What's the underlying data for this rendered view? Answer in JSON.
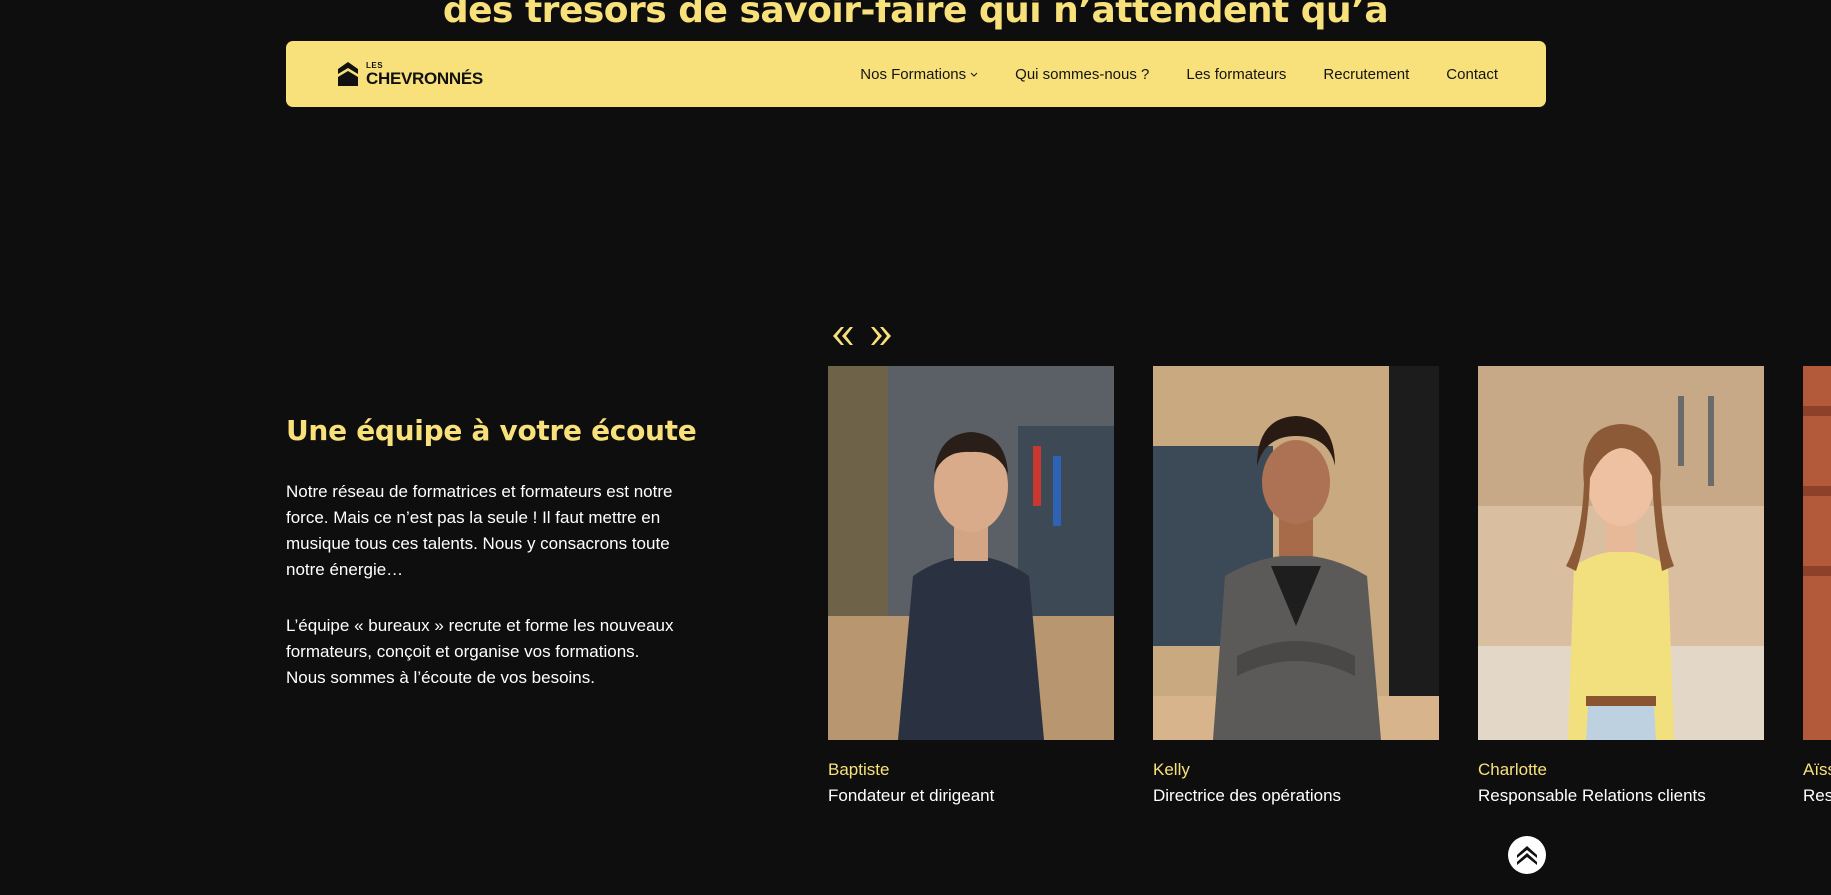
{
  "hero": {
    "fragment": "des trésors de savoir-faire qui n’attendent qu’à"
  },
  "nav": {
    "logo_small": "LES",
    "logo_big": "CHEVRONNÉS",
    "items": [
      {
        "label": "Nos Formations",
        "dropdown": true
      },
      {
        "label": "Qui sommes-nous ?"
      },
      {
        "label": "Les formateurs"
      },
      {
        "label": "Recrutement"
      },
      {
        "label": "Contact"
      }
    ]
  },
  "team": {
    "heading": "Une équipe à votre écoute",
    "paragraph1": "Notre réseau de formatrices et formateurs est notre force. Mais ce n’est pas la seule ! Il faut mettre en musique tous ces talents. Nous y consacrons toute notre énergie…",
    "paragraph2": "L’équipe « bureaux » recrute et forme les nouveaux formateurs, conçoit et organise vos formations. Nous sommes à l’écoute de vos besoins.",
    "members": [
      {
        "name": "Baptiste",
        "role": "Fondateur et dirigeant"
      },
      {
        "name": "Kelly",
        "role": "Directrice des opérations"
      },
      {
        "name": "Charlotte",
        "role": "Responsable Relations clients"
      },
      {
        "name": "Aïss",
        "role": "Res"
      }
    ]
  },
  "colors": {
    "accent": "#f8e17a",
    "background": "#0e0e0e",
    "text": "#ffffff"
  },
  "icons": {
    "prev": "double-chevron-left-icon",
    "next": "double-chevron-right-icon",
    "scroll_top": "chevron-up-icon"
  }
}
